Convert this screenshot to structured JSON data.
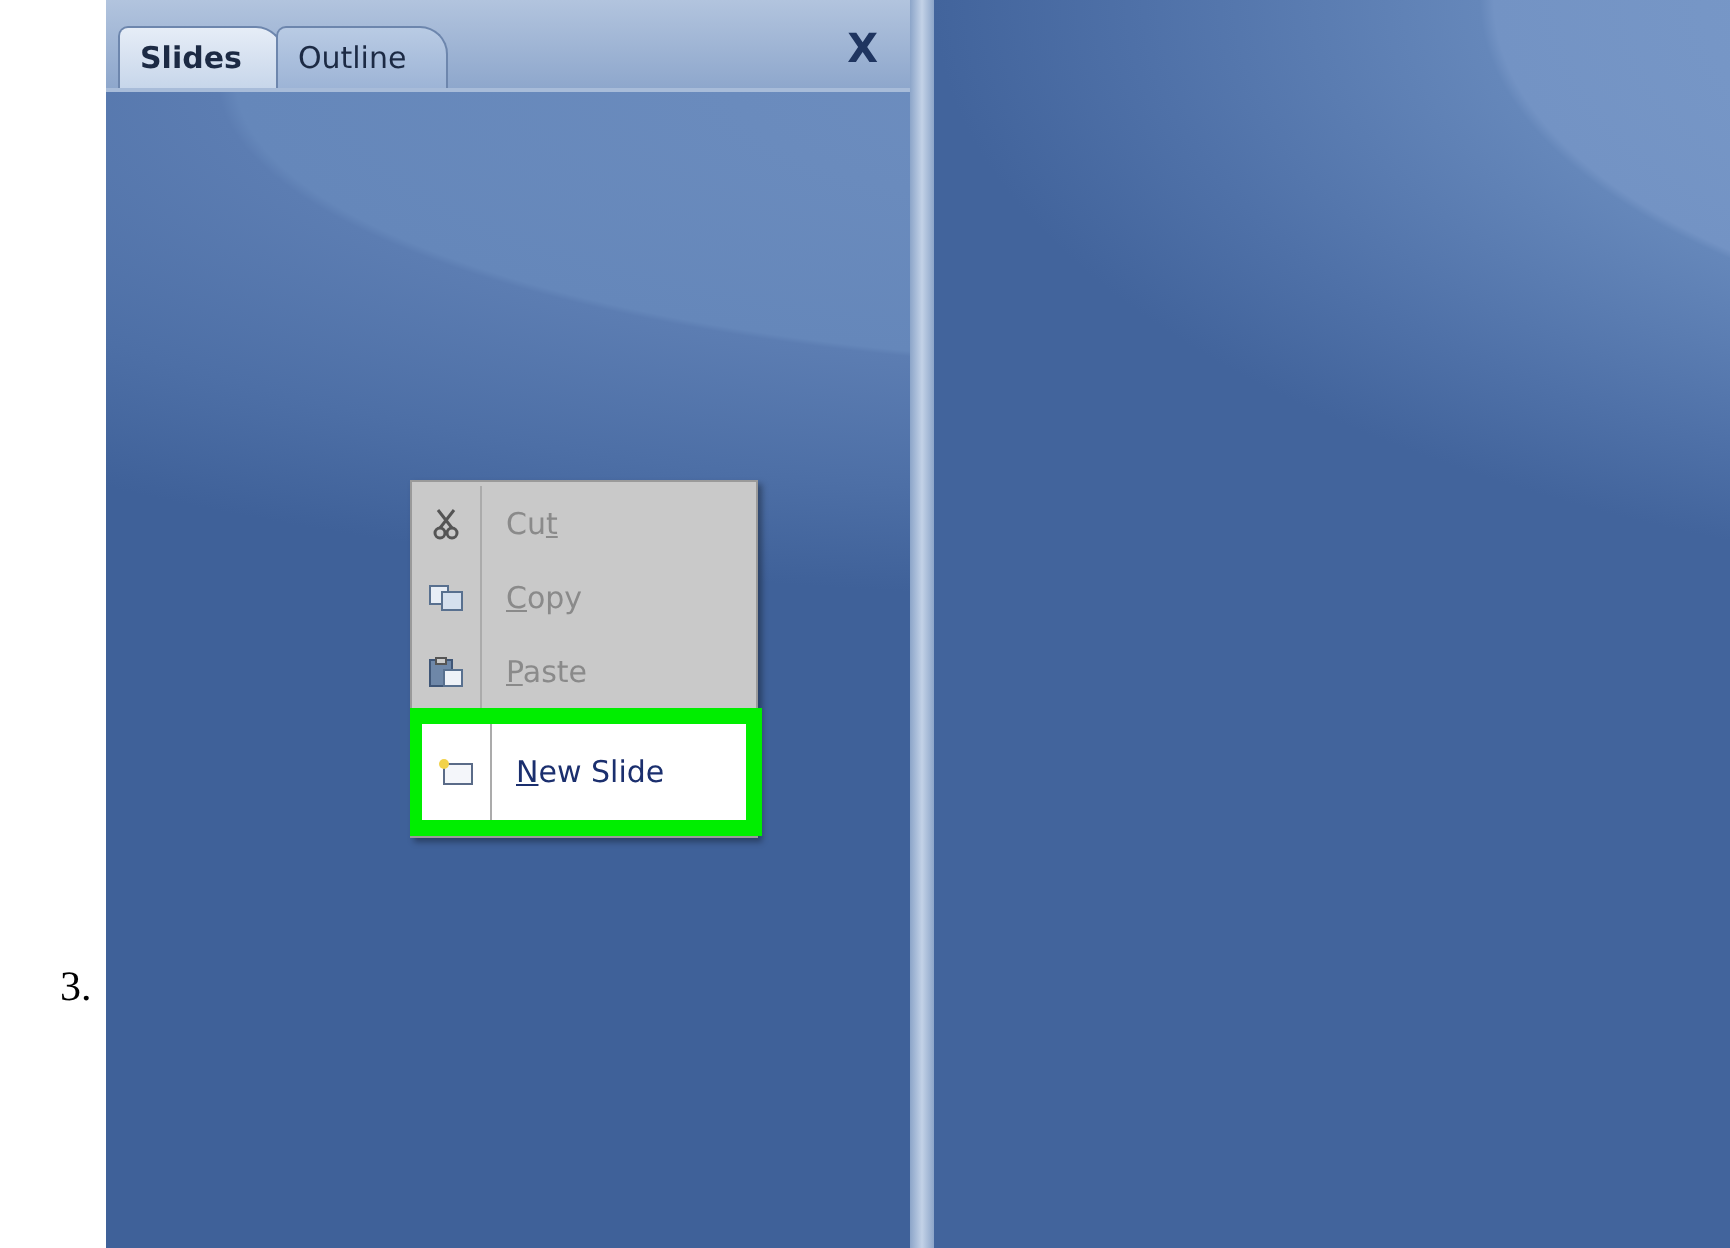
{
  "step_number": "3.",
  "tabs": [
    {
      "label": "Slides",
      "selected": true
    },
    {
      "label": "Outline",
      "selected": false
    }
  ],
  "close_glyph": "X",
  "context_menu": [
    {
      "pre": "Cu",
      "key": "t",
      "kind": "scissors",
      "disabled": true,
      "selected": false
    },
    {
      "key": "C",
      "post": "opy",
      "kind": "copy",
      "disabled": true,
      "selected": false
    },
    {
      "key": "P",
      "post": "aste",
      "kind": "paste",
      "disabled": true,
      "selected": false
    },
    {
      "key": "N",
      "post": "ew Slide",
      "kind": "slide",
      "disabled": false,
      "selected": true
    }
  ]
}
